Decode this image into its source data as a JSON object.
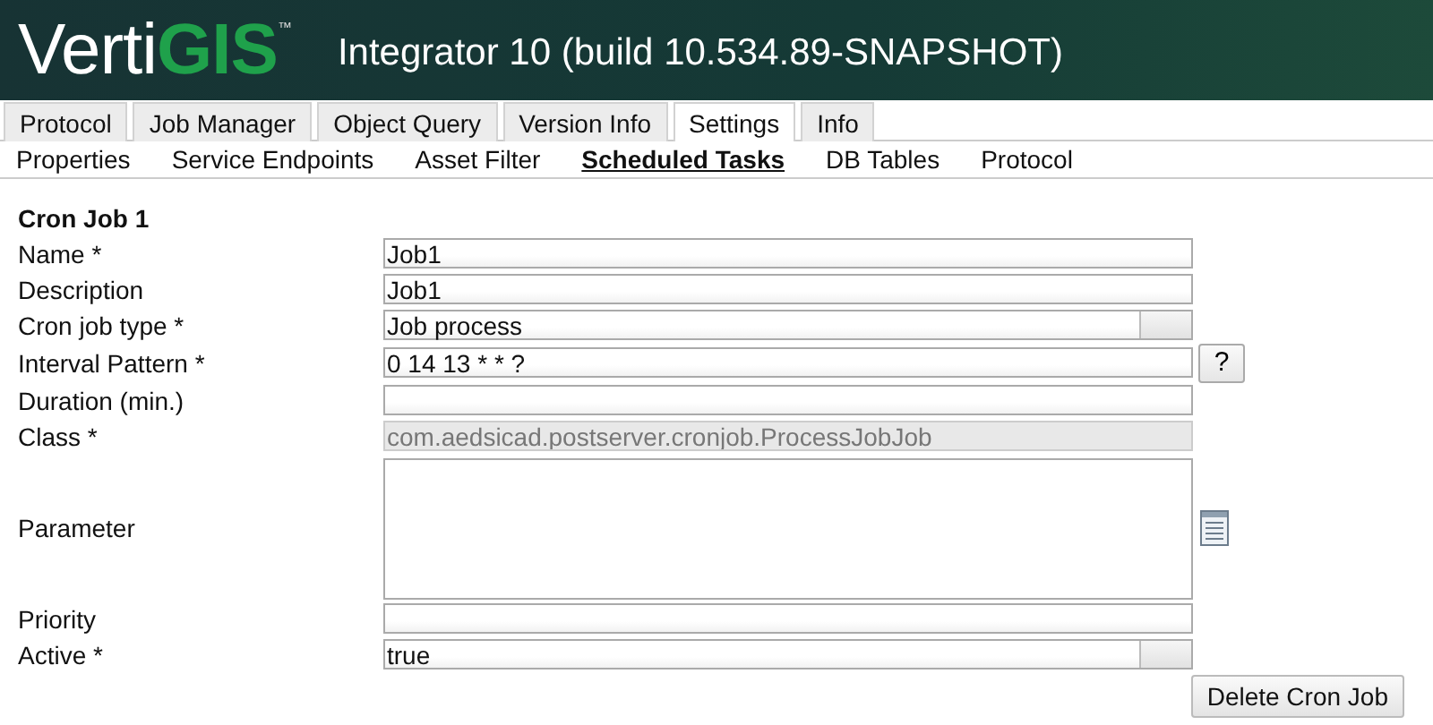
{
  "header": {
    "logo": {
      "light": "Verti",
      "bold": "GIS",
      "mark": "™"
    },
    "title": "Integrator 10 (build 10.534.89-SNAPSHOT)"
  },
  "tabs": [
    {
      "label": "Protocol",
      "selected": false
    },
    {
      "label": "Job Manager",
      "selected": false
    },
    {
      "label": "Object Query",
      "selected": false
    },
    {
      "label": "Version Info",
      "selected": false
    },
    {
      "label": "Settings",
      "selected": true
    },
    {
      "label": "Info",
      "selected": false
    }
  ],
  "subtabs": [
    {
      "label": "Properties",
      "selected": false
    },
    {
      "label": "Service Endpoints",
      "selected": false
    },
    {
      "label": "Asset Filter",
      "selected": false
    },
    {
      "label": "Scheduled Tasks",
      "selected": true
    },
    {
      "label": "DB Tables",
      "selected": false
    },
    {
      "label": "Protocol",
      "selected": false
    }
  ],
  "form": {
    "title": "Cron Job 1",
    "fields": [
      {
        "label": "Name *",
        "kind": "text",
        "value": "Job1"
      },
      {
        "label": "Description",
        "kind": "text",
        "value": "Job1"
      },
      {
        "label": "Cron job type *",
        "kind": "select",
        "value": "Job process"
      },
      {
        "label": "Interval Pattern *",
        "kind": "help",
        "value": "0 14 13 * * ?",
        "button": "?"
      },
      {
        "label": "Duration (min.)",
        "kind": "text"
      },
      {
        "label": "Class *",
        "kind": "disabled",
        "value": "com.aedsicad.postserver.cronjob.ProcessJobJob"
      },
      {
        "label": "Parameter",
        "kind": "textarea"
      },
      {
        "label": "Priority",
        "kind": "text"
      },
      {
        "label": "Active *",
        "kind": "select",
        "value": "true"
      }
    ],
    "delete_button": "Delete Cron Job"
  }
}
